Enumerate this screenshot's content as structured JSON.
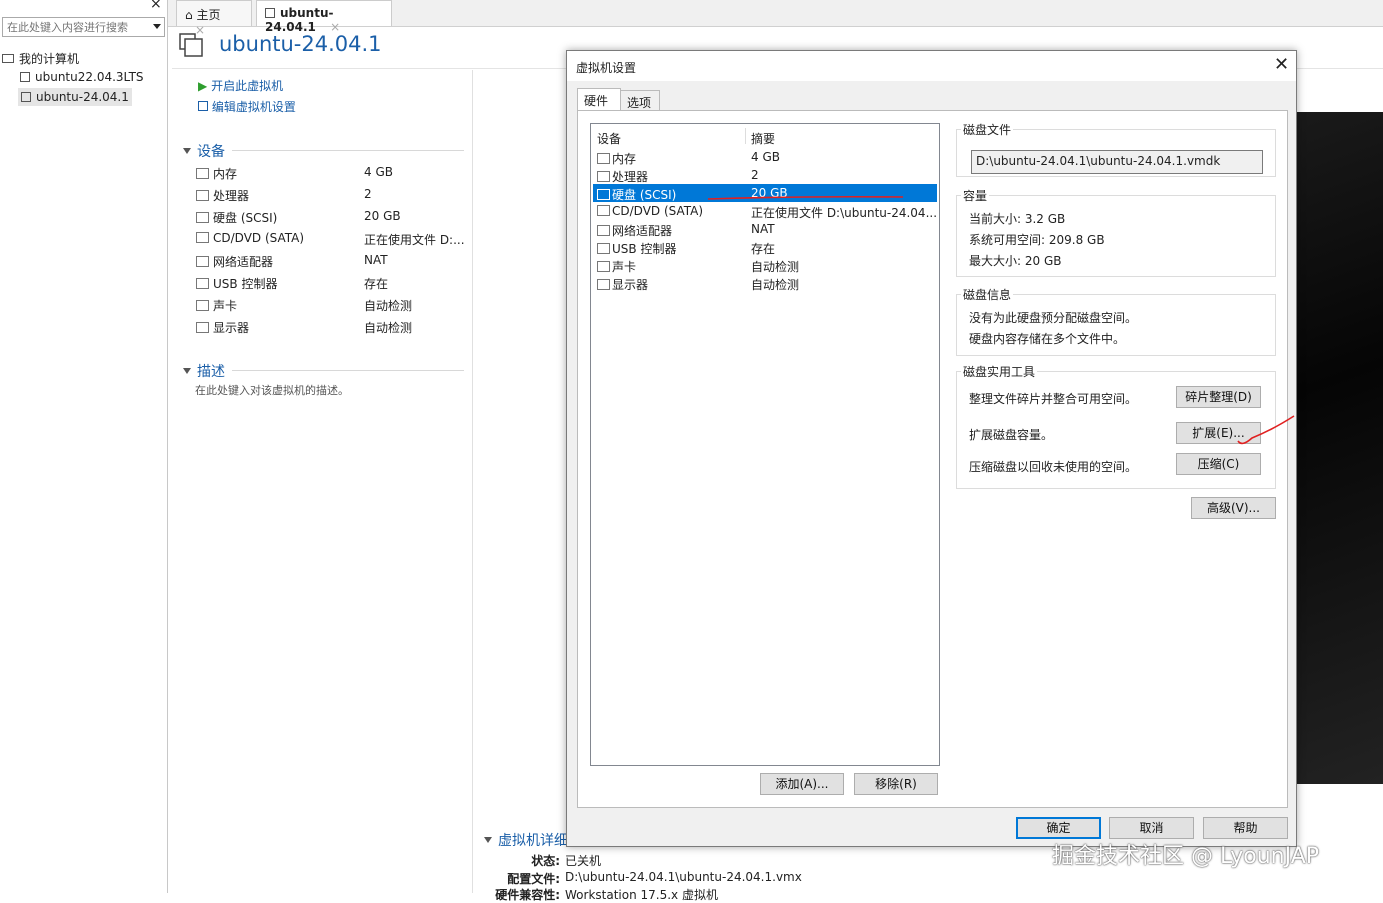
{
  "sidebar": {
    "search_placeholder": "在此处键入内容进行搜索",
    "close": "×",
    "tree": {
      "root": "我的计算机",
      "items": [
        "ubuntu22.04.3LTS",
        "ubuntu-24.04.1"
      ]
    }
  },
  "tabs": [
    {
      "label": "主页",
      "close": "×"
    },
    {
      "label": "ubuntu-24.04.1",
      "close": "×"
    }
  ],
  "vm": {
    "title": "ubuntu-24.04.1",
    "actions": {
      "power_on": "开启此虚拟机",
      "edit": "编辑虚拟机设置"
    },
    "devices_header": "设备",
    "devices": [
      {
        "name": "内存",
        "value": "4 GB"
      },
      {
        "name": "处理器",
        "value": "2"
      },
      {
        "name": "硬盘 (SCSI)",
        "value": "20 GB"
      },
      {
        "name": "CD/DVD (SATA)",
        "value": "正在使用文件 D:..."
      },
      {
        "name": "网络适配器",
        "value": "NAT"
      },
      {
        "name": "USB 控制器",
        "value": "存在"
      },
      {
        "name": "声卡",
        "value": "自动检测"
      },
      {
        "name": "显示器",
        "value": "自动检测"
      }
    ],
    "description_header": "描述",
    "description_placeholder": "在此处键入对该虚拟机的描述。",
    "details": {
      "header": "虚拟机详细",
      "status_label": "状态:",
      "status_value": "已关机",
      "config_label": "配置文件:",
      "config_value": "D:\\ubuntu-24.04.1\\ubuntu-24.04.1.vmx",
      "compat_label": "硬件兼容性:",
      "compat_value": "Workstation 17.5.x 虚拟机"
    }
  },
  "dialog": {
    "title": "虚拟机设置",
    "close": "✕",
    "tabs": [
      "硬件",
      "选项"
    ],
    "list": {
      "col_device": "设备",
      "col_summary": "摘要",
      "rows": [
        {
          "name": "内存",
          "summary": "4 GB"
        },
        {
          "name": "处理器",
          "summary": "2"
        },
        {
          "name": "硬盘 (SCSI)",
          "summary": "20 GB"
        },
        {
          "name": "CD/DVD (SATA)",
          "summary": "正在使用文件 D:\\ubuntu-24.04..."
        },
        {
          "name": "网络适配器",
          "summary": "NAT"
        },
        {
          "name": "USB 控制器",
          "summary": "存在"
        },
        {
          "name": "声卡",
          "summary": "自动检测"
        },
        {
          "name": "显示器",
          "summary": "自动检测"
        }
      ],
      "selected_index": 2
    },
    "add_button": "添加(A)...",
    "remove_button": "移除(R)",
    "disk_file": {
      "label": "磁盘文件",
      "path": "D:\\ubuntu-24.04.1\\ubuntu-24.04.1.vmdk"
    },
    "capacity": {
      "label": "容量",
      "current": "当前大小: 3.2 GB",
      "available": "系统可用空间: 209.8 GB",
      "max": "最大大小: 20 GB"
    },
    "disk_info": {
      "label": "磁盘信息",
      "line1": "没有为此硬盘预分配磁盘空间。",
      "line2": "硬盘内容存储在多个文件中。"
    },
    "utilities": {
      "label": "磁盘实用工具",
      "defrag_text": "整理文件碎片并整合可用空间。",
      "defrag_button": "碎片整理(D)",
      "expand_text": "扩展磁盘容量。",
      "expand_button": "扩展(E)...",
      "compact_text": "压缩磁盘以回收未使用的空间。",
      "compact_button": "压缩(C)"
    },
    "advanced_button": "高级(V)...",
    "ok_button": "确定",
    "cancel_button": "取消",
    "help_button": "帮助"
  },
  "watermark": "掘金技术社区 @ LyounJAP",
  "colors": {
    "accent": "#1b5fa8",
    "selection": "#0078d7",
    "annotation": "#e02020"
  }
}
